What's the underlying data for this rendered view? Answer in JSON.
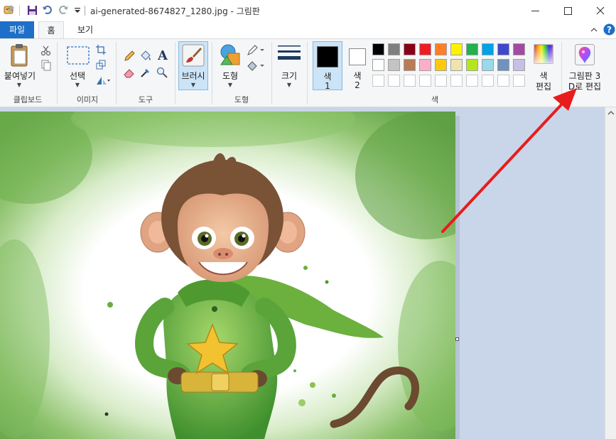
{
  "window": {
    "title": "ai-generated-8674827_1280.jpg - 그림판"
  },
  "tabs": [
    {
      "label": "파일"
    },
    {
      "label": "홈"
    },
    {
      "label": "보기"
    }
  ],
  "ribbon": {
    "clipboard": {
      "paste_label": "붙여넣기",
      "group_label": "클립보드"
    },
    "image": {
      "select_label": "선택",
      "group_label": "이미지"
    },
    "tools": {
      "group_label": "도구"
    },
    "brushes": {
      "label": "브러시"
    },
    "shapes": {
      "label": "도형",
      "group_label": "도형"
    },
    "size": {
      "label": "크기"
    },
    "colors": {
      "color1_line1": "색",
      "color1_line2": "1",
      "color2_line1": "색",
      "color2_line2": "2",
      "edit_line1": "색",
      "edit_line2": "편집",
      "group_label": "색",
      "palette_row1": [
        "#000000",
        "#7f7f7f",
        "#880015",
        "#ed1c24",
        "#ff7f27",
        "#fff200",
        "#22b14c",
        "#00a2e8",
        "#3f48cc",
        "#a349a4"
      ],
      "palette_row2": [
        "#ffffff",
        "#c3c3c3",
        "#b97a57",
        "#ffaec9",
        "#ffc90e",
        "#efe4b0",
        "#b5e61d",
        "#99d9ea",
        "#7092be",
        "#c8bfe7"
      ]
    },
    "paint3d": {
      "line1": "그림판 3",
      "line2": "D로 편집"
    }
  },
  "colors": {
    "accent": "#1e6fc8",
    "annotation_arrow": "#e81c1c"
  }
}
